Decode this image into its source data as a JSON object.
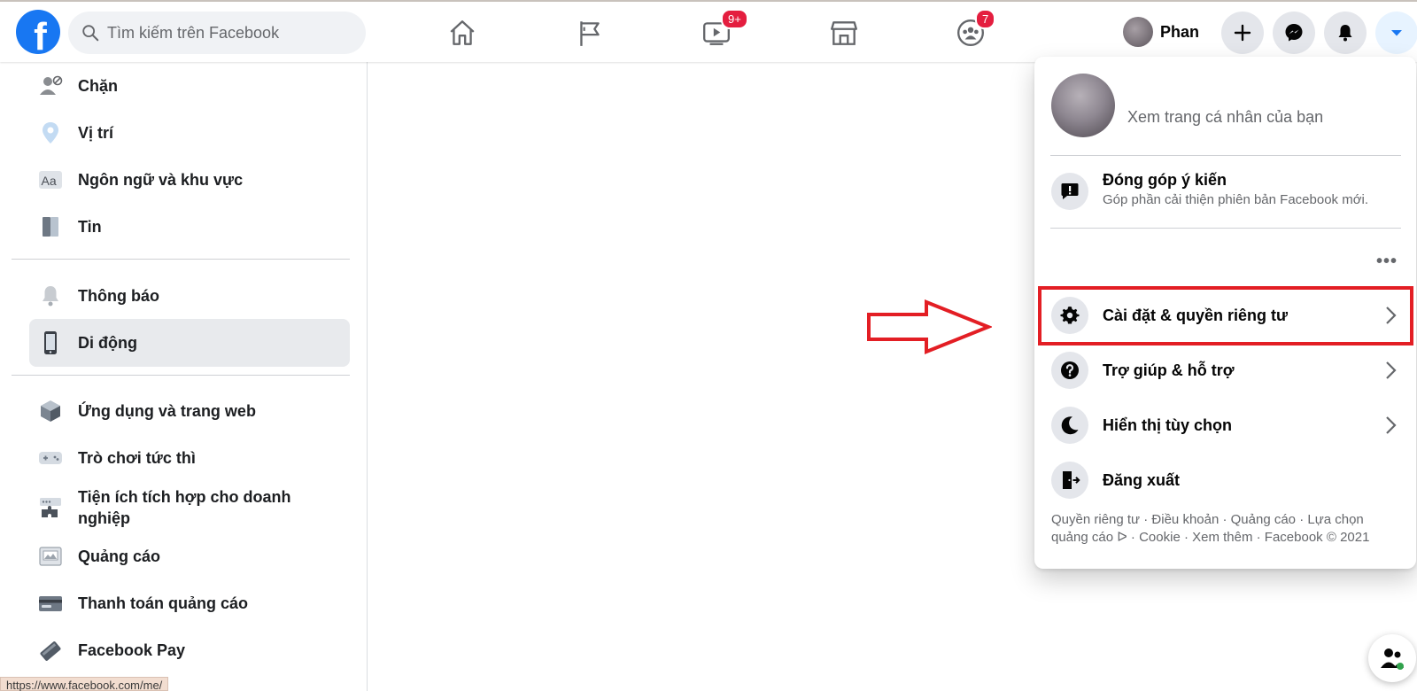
{
  "search": {
    "placeholder": "Tìm kiếm trên Facebook"
  },
  "nav": {
    "home_icon": "home-icon",
    "pages_icon": "flag-icon",
    "watch_icon": "video-icon",
    "watch_badge": "9+",
    "marketplace_icon": "store-icon",
    "groups_icon": "groups-icon",
    "groups_badge": "7"
  },
  "profile": {
    "name": "Phan"
  },
  "actions": [
    "plus-icon",
    "messenger-icon",
    "bell-icon",
    "caret-down-icon"
  ],
  "sidebar": {
    "items": [
      {
        "label": "Chặn",
        "icon": "block-user-icon"
      },
      {
        "label": "Vị trí",
        "icon": "location-icon"
      },
      {
        "label": "Ngôn ngữ và khu vực",
        "icon": "language-icon"
      },
      {
        "label": "Tin",
        "icon": "book-icon"
      },
      {
        "label": "Thông báo",
        "icon": "bell-icon"
      },
      {
        "label": "Di động",
        "icon": "mobile-icon"
      },
      {
        "label": "Ứng dụng và trang web",
        "icon": "cube-icon"
      },
      {
        "label": "Trò chơi tức thì",
        "icon": "gamepad-icon"
      },
      {
        "label": "Tiện ích tích hợp cho doanh nghiệp",
        "icon": "puzzle-icon"
      },
      {
        "label": "Quảng cáo",
        "icon": "ad-icon"
      },
      {
        "label": "Thanh toán quảng cáo",
        "icon": "card-icon"
      },
      {
        "label": "Facebook Pay",
        "icon": "pay-icon"
      }
    ],
    "active": "Di động"
  },
  "status_url": "https://www.facebook.com/me/",
  "menu": {
    "profile_text": "Xem trang cá nhân của bạn",
    "feedback_title": "Đóng góp ý kiến",
    "feedback_sub": "Góp phần cải thiện phiên bản Facebook mới.",
    "more": "•••",
    "items": [
      {
        "label": "Cài đặt & quyền riêng tư",
        "icon": "gear-icon"
      },
      {
        "label": "Trợ giúp & hỗ trợ",
        "icon": "help-icon"
      },
      {
        "label": "Hiển thị tùy chọn",
        "icon": "moon-icon"
      },
      {
        "label": "Đăng xuất",
        "icon": "logout-icon"
      }
    ],
    "footer": "Quyền riêng tư · Điều khoản · Quảng cáo · Lựa chọn quảng cáo ᐅ · Cookie · Xem thêm · Facebook © 2021"
  },
  "colors": {
    "brand": "#1877f2",
    "highlight": "#e31e24",
    "badge": "#e41e3f"
  }
}
